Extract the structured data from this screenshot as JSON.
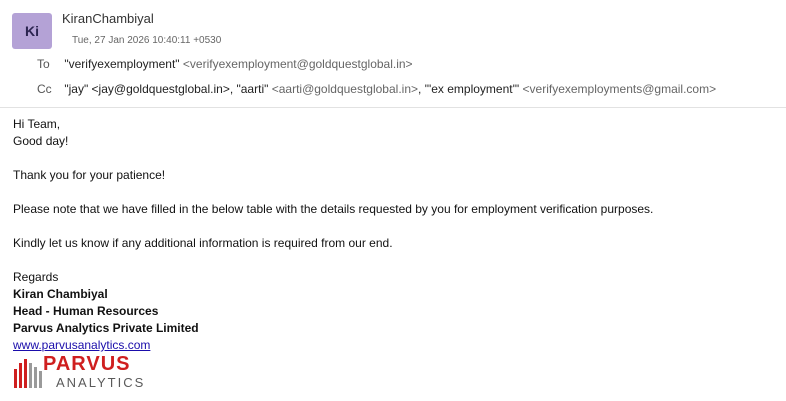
{
  "message": {
    "sender": {
      "initials": "Ki",
      "name": "KiranChambiyal",
      "date": "Tue, 27 Jan 2026 10:40:11 +0530"
    },
    "to_label": "To",
    "to": [
      {
        "name": "\"verifyexemployment\"",
        "email": "<verifyexemployment@goldquestglobal.in>"
      }
    ],
    "cc_label": "Cc",
    "cc": [
      {
        "name": "\"jay\"",
        "email": "<jay@goldquestglobal.in>"
      },
      {
        "name": "\"aarti\"",
        "email": "<aarti@goldquestglobal.in>"
      },
      {
        "name": "\"'ex employment'\"",
        "email": "<verifyexemployments@gmail.com>"
      }
    ],
    "cc_separator": ", "
  },
  "body": {
    "greeting": "Hi Team,",
    "greeting2": "Good day!",
    "para1": "Thank you for your patience!",
    "para2": "Please note that we have filled in the below table with the details requested by you for employment verification purposes.",
    "para3": "Kindly let us know if any additional information is required from our end.",
    "regards": "Regards",
    "sig_name": "Kiran Chambiyal",
    "sig_title": "Head - Human Resources",
    "sig_company": "Parvus Analytics Private Limited",
    "sig_link": "www.parvusanalytics.com"
  },
  "logo": {
    "word": "PARVUS",
    "sub": "ANALYTICS",
    "brand_color": "#cf1f1f"
  },
  "colors": {
    "avatar_bg": "#b4a2d6",
    "link": "#1a0dab",
    "email_grey": "#666666"
  }
}
